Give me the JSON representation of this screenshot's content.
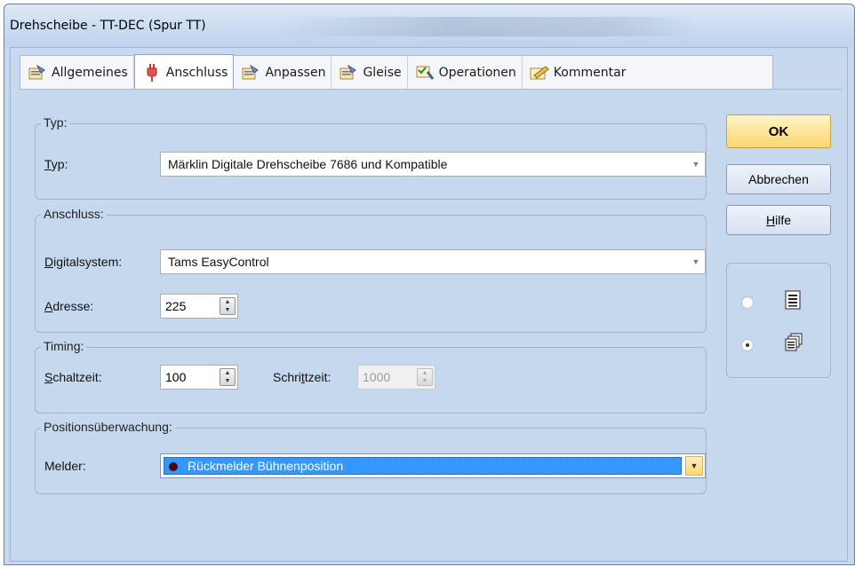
{
  "window": {
    "title": "Drehscheibe - TT-DEC (Spur TT)"
  },
  "tabs": [
    {
      "label": "Allgemeines",
      "icon": "properties-icon"
    },
    {
      "label": "Anschluss",
      "icon": "plug-icon"
    },
    {
      "label": "Anpassen",
      "icon": "properties-icon"
    },
    {
      "label": "Gleise",
      "icon": "properties-icon"
    },
    {
      "label": "Operationen",
      "icon": "operations-icon"
    },
    {
      "label": "Kommentar",
      "icon": "comment-icon"
    }
  ],
  "active_tab": "Anschluss",
  "groups": {
    "typ": {
      "legend": "Typ:",
      "label_typ_first": "T",
      "label_typ_rest": "yp:",
      "value": "Märklin Digitale Drehscheibe 7686 und Kompatible"
    },
    "anschluss": {
      "legend": "Anschluss:",
      "label_ds_first": "D",
      "label_ds_rest": "igitalsystem:",
      "digitalsystem": "Tams EasyControl",
      "label_ad_first": "A",
      "label_ad_rest": "dresse:",
      "adresse": "225"
    },
    "timing": {
      "legend": "Timing:",
      "label_sz_first": "S",
      "label_sz_rest": "chaltzeit:",
      "schaltzeit": "100",
      "label_st_a": "Schri",
      "label_st_u": "t",
      "label_st_b": "tzeit:",
      "schrittzeit": "1000"
    },
    "position": {
      "legend": "Positionsüberwachung:",
      "label_melder": "Melder:",
      "melder": "Rückmelder Bühnenposition"
    }
  },
  "buttons": {
    "ok": "OK",
    "cancel": "Abbrechen",
    "help_first": "H",
    "help_rest": "ilfe"
  },
  "view_options": [
    {
      "icon": "list-view-icon",
      "selected": false
    },
    {
      "icon": "cascade-view-icon",
      "selected": true
    }
  ]
}
